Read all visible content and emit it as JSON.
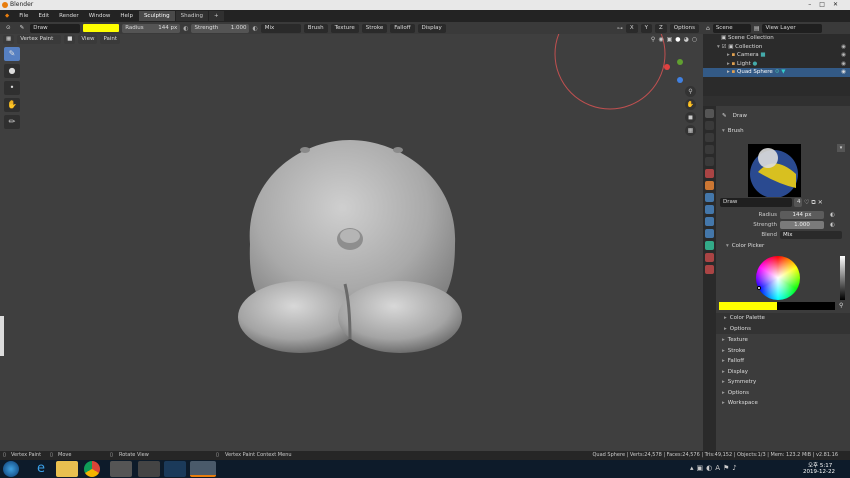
{
  "app": {
    "title": "Blender"
  },
  "menu": {
    "items": [
      "File",
      "Edit",
      "Render",
      "Window",
      "Help"
    ],
    "workspaces": [
      "Sculpting",
      "Shading"
    ],
    "add_tab": "+"
  },
  "toolbar": {
    "brush_name": "Draw",
    "radius_label": "Radius",
    "radius_value": "144 px",
    "strength_label": "Strength",
    "strength_value": "1.000",
    "blend": "Mix",
    "dropdowns": [
      "Brush",
      "Texture",
      "Stroke",
      "Falloff",
      "Display"
    ],
    "axes": [
      "X",
      "Y",
      "Z"
    ],
    "options": "Options",
    "color": "#ffff00"
  },
  "viewport_header": {
    "mode": "Vertex Paint",
    "view": "View",
    "paint": "Paint"
  },
  "scene": {
    "scene_label": "Scene",
    "view_layer_label": "View Layer"
  },
  "outliner": {
    "rows": [
      {
        "label": "Scene Collection",
        "indent": 0
      },
      {
        "label": "Collection",
        "indent": 1
      },
      {
        "label": "Camera",
        "indent": 2
      },
      {
        "label": "Light",
        "indent": 2
      },
      {
        "label": "Quad Sphere",
        "indent": 2,
        "selected": true
      }
    ]
  },
  "properties": {
    "tool_title": "Draw",
    "brush_section": "Brush",
    "brush_name": "Draw",
    "brush_users": "4",
    "radius_label": "Radius",
    "radius_value": "144 px",
    "strength_label": "Strength",
    "strength_value": "1.000",
    "blend_label": "Blend",
    "blend_value": "Mix",
    "color_picker": "Color Picker",
    "color_palette": "Color Palette",
    "options_sub": "Options",
    "sections": [
      "Texture",
      "Stroke",
      "Falloff",
      "Display",
      "Symmetry",
      "Options",
      "Workspace"
    ]
  },
  "status": {
    "left": [
      "Vertex Paint",
      "Move",
      "Rotate View",
      "Vertex Paint Context Menu"
    ],
    "right": "Quad Sphere | Verts:24,578 | Faces:24,576 | Tris:49,152 | Objects:1/3 | Mem: 123.2 MiB | v2.81.16"
  },
  "taskbar": {
    "time": "오후 5:17",
    "date": "2019-12-22"
  }
}
